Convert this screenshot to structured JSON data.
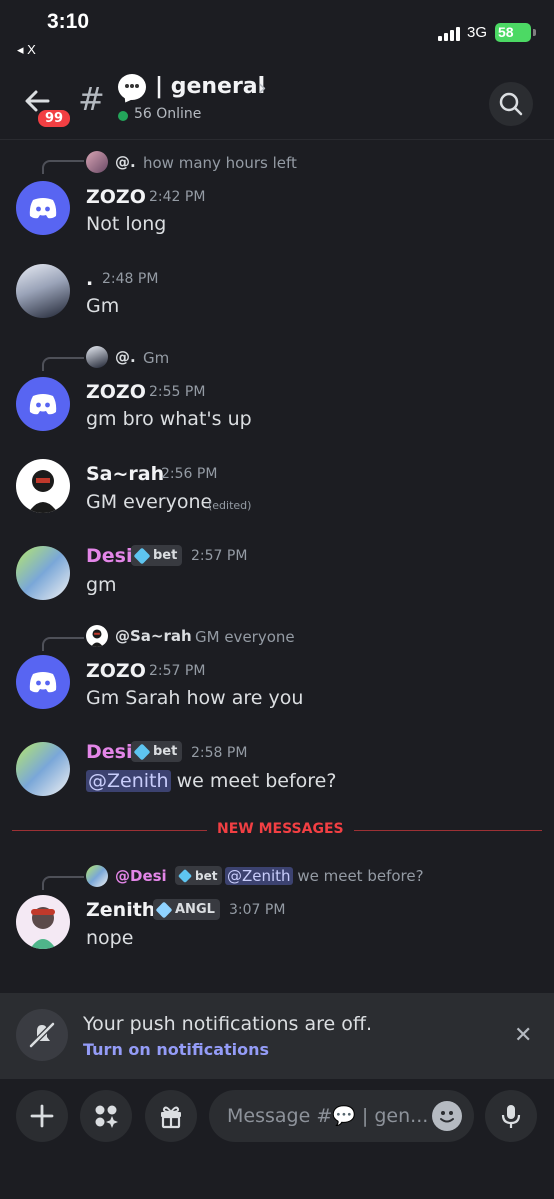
{
  "status_bar": {
    "time": "3:10",
    "back_app": "◂ X",
    "network": "3G",
    "battery": "58"
  },
  "header": {
    "unread_badge": "99",
    "channel_name": "| general",
    "online_count": "56 Online"
  },
  "messages": [
    {
      "reply_name": "@.",
      "reply_text": "how many hours left",
      "author": "ZOZO",
      "time": "2:42 PM",
      "text": "Not long"
    },
    {
      "author": ".",
      "time": "2:48 PM",
      "text": "Gm"
    },
    {
      "reply_name": "@.",
      "reply_text": "Gm",
      "author": "ZOZO",
      "time": "2:55 PM",
      "text": "gm bro what's up"
    },
    {
      "author": "Sa~rah",
      "time": "2:56 PM",
      "text": "GM everyone",
      "edited": "(edited)"
    },
    {
      "author": "Desi",
      "tag": "bet",
      "time": "2:57 PM",
      "text": "gm"
    },
    {
      "reply_name": "@Sa~rah",
      "reply_text": "GM everyone",
      "author": "ZOZO",
      "time": "2:57 PM",
      "text": "Gm Sarah how are you"
    },
    {
      "author": "Desi",
      "tag": "bet",
      "time": "2:58 PM",
      "mention": "@Zenith",
      "text": " we meet before?"
    },
    {
      "reply_name": "@Desi",
      "reply_tag": "bet",
      "reply_mention": "@Zenith",
      "reply_text": " we meet before?",
      "author": "Zenith",
      "tag": "ANGL",
      "time": "3:07 PM",
      "text": "nope"
    }
  ],
  "new_messages_label": "NEW MESSAGES",
  "notification": {
    "title": "Your push notifications are off.",
    "link": "Turn on notifications"
  },
  "composer": {
    "placeholder": "Message #💬 | gen..."
  },
  "colors": {
    "background": "#1c1d22",
    "accent": "#5865f2",
    "link": "#949cf7",
    "alert": "#f23f43",
    "online": "#23a55a",
    "role_pink": "#e386e8"
  }
}
